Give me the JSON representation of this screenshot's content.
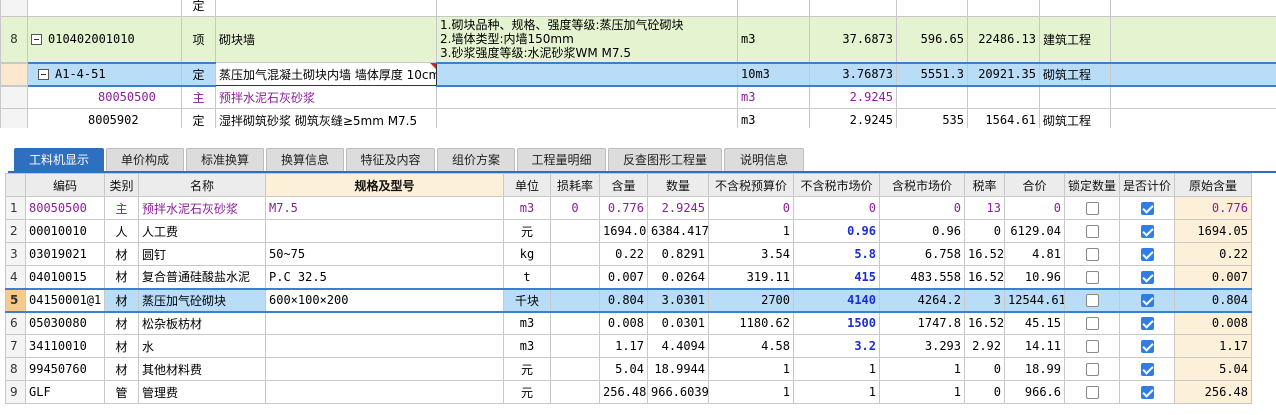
{
  "top_grid": {
    "rows": [
      {
        "num": "",
        "code": "",
        "type": "定",
        "name": "",
        "desc": "",
        "unit": "",
        "qty": "",
        "price": "",
        "total": "",
        "category": ""
      },
      {
        "num": "8",
        "code": "010402001010",
        "type": "项",
        "name": "砌块墙",
        "desc": [
          "1.砌块品种、规格、强度等级:蒸压加气砼砌块",
          "2.墙体类型:内墙150mm",
          "3.砂浆强度等级:水泥砂浆WM M7.5"
        ],
        "unit": "m3",
        "qty": "37.6873",
        "price": "596.65",
        "total": "22486.13",
        "category": "建筑工程"
      },
      {
        "num": "",
        "code": "A1-4-51",
        "type": "定",
        "name": "蒸压加气混凝土砌块内墙 墙体厚度 10cm",
        "desc": "",
        "unit": "10m3",
        "qty": "3.76873",
        "price": "5551.3",
        "total": "20921.35",
        "category": "砌筑工程"
      },
      {
        "num": "",
        "code": "80050500",
        "type": "主",
        "name": "预拌水泥石灰砂浆",
        "desc": "",
        "unit": "m3",
        "qty": "2.9245",
        "price": "",
        "total": "",
        "category": ""
      },
      {
        "num": "",
        "code": "8005902",
        "type": "定",
        "name": "湿拌砌筑砂浆 砌筑灰缝≥5mm M7.5",
        "desc": "",
        "unit": "m3",
        "qty": "2.9245",
        "price": "535",
        "total": "1564.61",
        "category": "砌筑工程"
      }
    ]
  },
  "tabs": [
    "工料机显示",
    "单价构成",
    "标准换算",
    "换算信息",
    "特征及内容",
    "组价方案",
    "工程量明细",
    "反查图形工程量",
    "说明信息"
  ],
  "bottom_grid": {
    "headers": [
      "编码",
      "类别",
      "名称",
      "规格及型号",
      "单位",
      "损耗率",
      "含量",
      "数量",
      "不含税预算价",
      "不含税市场价",
      "含税市场价",
      "税率",
      "合价",
      "锁定数量",
      "是否计价",
      "原始含量"
    ],
    "rows": [
      {
        "rn": "1",
        "code": "80050500",
        "cat": "主",
        "name": "预拌水泥石灰砂浆",
        "spec": "M7.5",
        "unit": "m3",
        "loss": "0",
        "content": "0.776",
        "qty": "2.9245",
        "budget": "0",
        "market": "0",
        "tax_market": "0",
        "tax_rate": "13",
        "total": "0",
        "locked": false,
        "priced": true,
        "orig": "0.776"
      },
      {
        "rn": "2",
        "code": "00010010",
        "cat": "人",
        "name": "人工费",
        "spec": "",
        "unit": "元",
        "loss": "",
        "content": "1694.05",
        "qty": "6384.4171",
        "budget": "1",
        "market": "0.96",
        "tax_market": "0.96",
        "tax_rate": "0",
        "total": "6129.04",
        "locked": false,
        "priced": true,
        "orig": "1694.05"
      },
      {
        "rn": "3",
        "code": "03019021",
        "cat": "材",
        "name": "圆钉",
        "spec": "50~75",
        "unit": "kg",
        "loss": "",
        "content": "0.22",
        "qty": "0.8291",
        "budget": "3.54",
        "market": "5.8",
        "tax_market": "6.758",
        "tax_rate": "16.52",
        "total": "4.81",
        "locked": false,
        "priced": true,
        "orig": "0.22"
      },
      {
        "rn": "4",
        "code": "04010015",
        "cat": "材",
        "name": "复合普通硅酸盐水泥",
        "spec": "P.C 32.5",
        "unit": "t",
        "loss": "",
        "content": "0.007",
        "qty": "0.0264",
        "budget": "319.11",
        "market": "415",
        "tax_market": "483.558",
        "tax_rate": "16.52",
        "total": "10.96",
        "locked": false,
        "priced": true,
        "orig": "0.007"
      },
      {
        "rn": "5",
        "code": "04150001@1",
        "cat": "材",
        "name": "蒸压加气砼砌块",
        "spec": "600×100×200",
        "unit": "千块",
        "loss": "",
        "content": "0.804",
        "qty": "3.0301",
        "budget": "2700",
        "market": "4140",
        "tax_market": "4264.2",
        "tax_rate": "3",
        "total": "12544.61",
        "locked": false,
        "priced": true,
        "orig": "0.804"
      },
      {
        "rn": "6",
        "code": "05030080",
        "cat": "材",
        "name": "松杂板枋材",
        "spec": "",
        "unit": "m3",
        "loss": "",
        "content": "0.008",
        "qty": "0.0301",
        "budget": "1180.62",
        "market": "1500",
        "tax_market": "1747.8",
        "tax_rate": "16.52",
        "total": "45.15",
        "locked": false,
        "priced": true,
        "orig": "0.008"
      },
      {
        "rn": "7",
        "code": "34110010",
        "cat": "材",
        "name": "水",
        "spec": "",
        "unit": "m3",
        "loss": "",
        "content": "1.17",
        "qty": "4.4094",
        "budget": "4.58",
        "market": "3.2",
        "tax_market": "3.293",
        "tax_rate": "2.92",
        "total": "14.11",
        "locked": false,
        "priced": true,
        "orig": "1.17"
      },
      {
        "rn": "8",
        "code": "99450760",
        "cat": "材",
        "name": "其他材料费",
        "spec": "",
        "unit": "元",
        "loss": "",
        "content": "5.04",
        "qty": "18.9944",
        "budget": "1",
        "market": "1",
        "tax_market": "1",
        "tax_rate": "0",
        "total": "18.99",
        "locked": false,
        "priced": true,
        "orig": "5.04"
      },
      {
        "rn": "9",
        "code": "GLF",
        "cat": "管",
        "name": "管理费",
        "spec": "",
        "unit": "元",
        "loss": "",
        "content": "256.48",
        "qty": "966.6039",
        "budget": "1",
        "market": "1",
        "tax_market": "1",
        "tax_rate": "0",
        "total": "966.6",
        "locked": false,
        "priced": true,
        "orig": "256.48"
      }
    ]
  }
}
